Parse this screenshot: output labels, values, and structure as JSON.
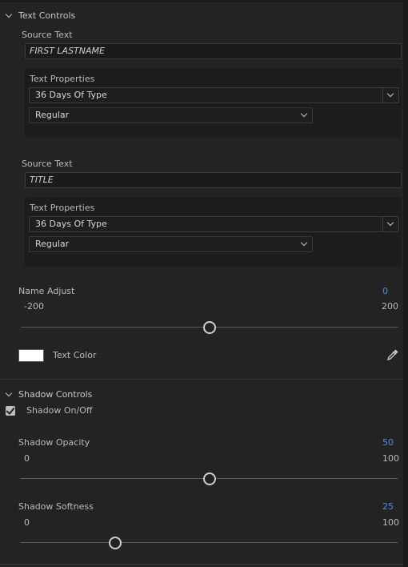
{
  "text_controls": {
    "header": "Text Controls",
    "source_text_1": {
      "label": "Source Text",
      "value": "FIRST LASTNAME",
      "properties_label": "Text Properties",
      "font": "36 Days Of Type",
      "style": "Regular"
    },
    "source_text_2": {
      "label": "Source Text",
      "value": "TITLE",
      "properties_label": "Text Properties",
      "font": "36 Days Of Type",
      "style": "Regular"
    },
    "name_adjust": {
      "label": "Name Adjust",
      "value": "0",
      "min": "-200",
      "max": "200",
      "fraction": 0.5
    },
    "text_color": {
      "label": "Text Color",
      "color": "#ffffff"
    }
  },
  "shadow_controls": {
    "header": "Shadow Controls",
    "shadow_toggle": {
      "label": "Shadow On/Off",
      "checked": true
    },
    "shadow_opacity": {
      "label": "Shadow Opacity",
      "value": "50",
      "min": "0",
      "max": "100",
      "fraction": 0.5
    },
    "shadow_softness": {
      "label": "Shadow Softness",
      "value": "25",
      "min": "0",
      "max": "100",
      "fraction": 0.25
    }
  },
  "colors": {
    "accent": "#4a8fe0",
    "panel_bg": "#232323"
  },
  "icons": [
    "chevron-down-icon",
    "eyedropper-icon",
    "checkbox-checked-icon"
  ]
}
